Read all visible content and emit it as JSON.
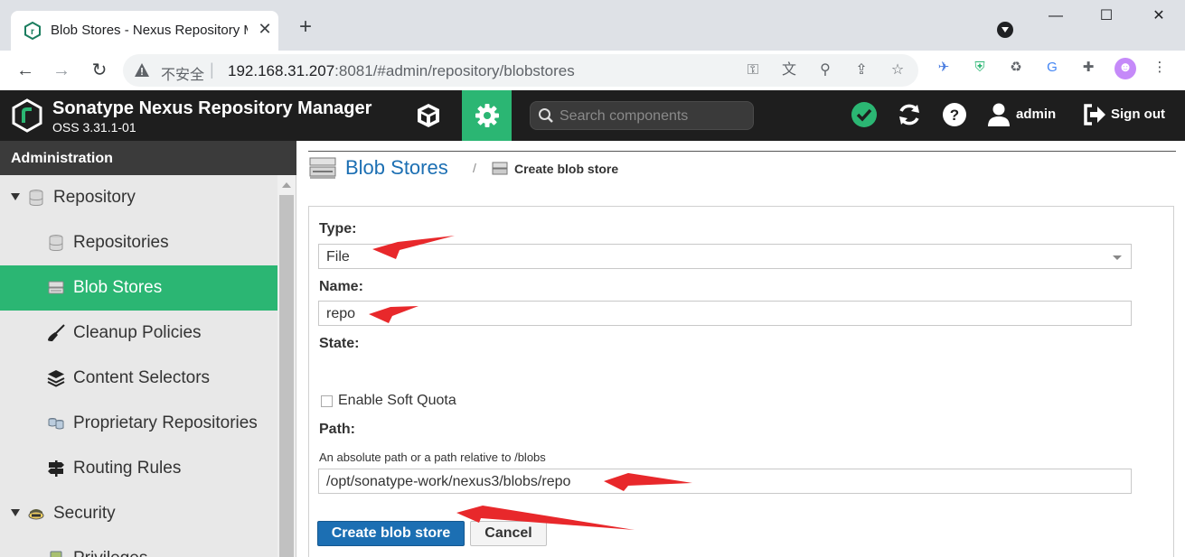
{
  "browser": {
    "tab_title": "Blob Stores - Nexus Repository Manager",
    "new_tab_symbol": "+",
    "close_symbol": "✕",
    "security_label": "不安全",
    "url_host": "192.168.31.207",
    "url_rest": ":8081/#admin/repository/blobstores",
    "window_controls": [
      "minimize",
      "maximize",
      "close"
    ]
  },
  "header": {
    "product_name": "Sonatype Nexus Repository Manager",
    "version": "OSS 3.31.1-01",
    "search_placeholder": "Search components",
    "user_label": "admin",
    "signout_label": "Sign out"
  },
  "sidebar": {
    "title": "Administration",
    "items": [
      {
        "label": "Repository",
        "icon": "database-icon",
        "level": 0,
        "expanded": true
      },
      {
        "label": "Repositories",
        "icon": "database-icon",
        "level": 1
      },
      {
        "label": "Blob Stores",
        "icon": "blob-store-icon",
        "level": 1,
        "active": true
      },
      {
        "label": "Cleanup Policies",
        "icon": "broom-icon",
        "level": 1
      },
      {
        "label": "Content Selectors",
        "icon": "layers-icon",
        "level": 1
      },
      {
        "label": "Proprietary Repositories",
        "icon": "proprietary-icon",
        "level": 1
      },
      {
        "label": "Routing Rules",
        "icon": "signpost-icon",
        "level": 1
      },
      {
        "label": "Security",
        "icon": "security-icon",
        "level": 0,
        "expanded": true
      },
      {
        "label": "Privileges",
        "icon": "privilege-icon",
        "level": 1
      }
    ]
  },
  "breadcrumb": {
    "title": "Blob Stores",
    "separator": "/",
    "current": "Create blob store"
  },
  "form": {
    "type_label": "Type:",
    "type_value": "File",
    "name_label": "Name:",
    "name_value": "repo",
    "state_label": "State:",
    "soft_quota_label": "Enable Soft Quota",
    "soft_quota_checked": false,
    "path_label": "Path:",
    "path_help": "An absolute path or a path relative to /blobs",
    "path_value": "/opt/sonatype-work/nexus3/blobs/repo",
    "create_button": "Create blob store",
    "cancel_button": "Cancel"
  },
  "colors": {
    "nexus_green": "#2bb673",
    "link_blue": "#1c6fb3",
    "annotation_red": "#e8282b"
  }
}
